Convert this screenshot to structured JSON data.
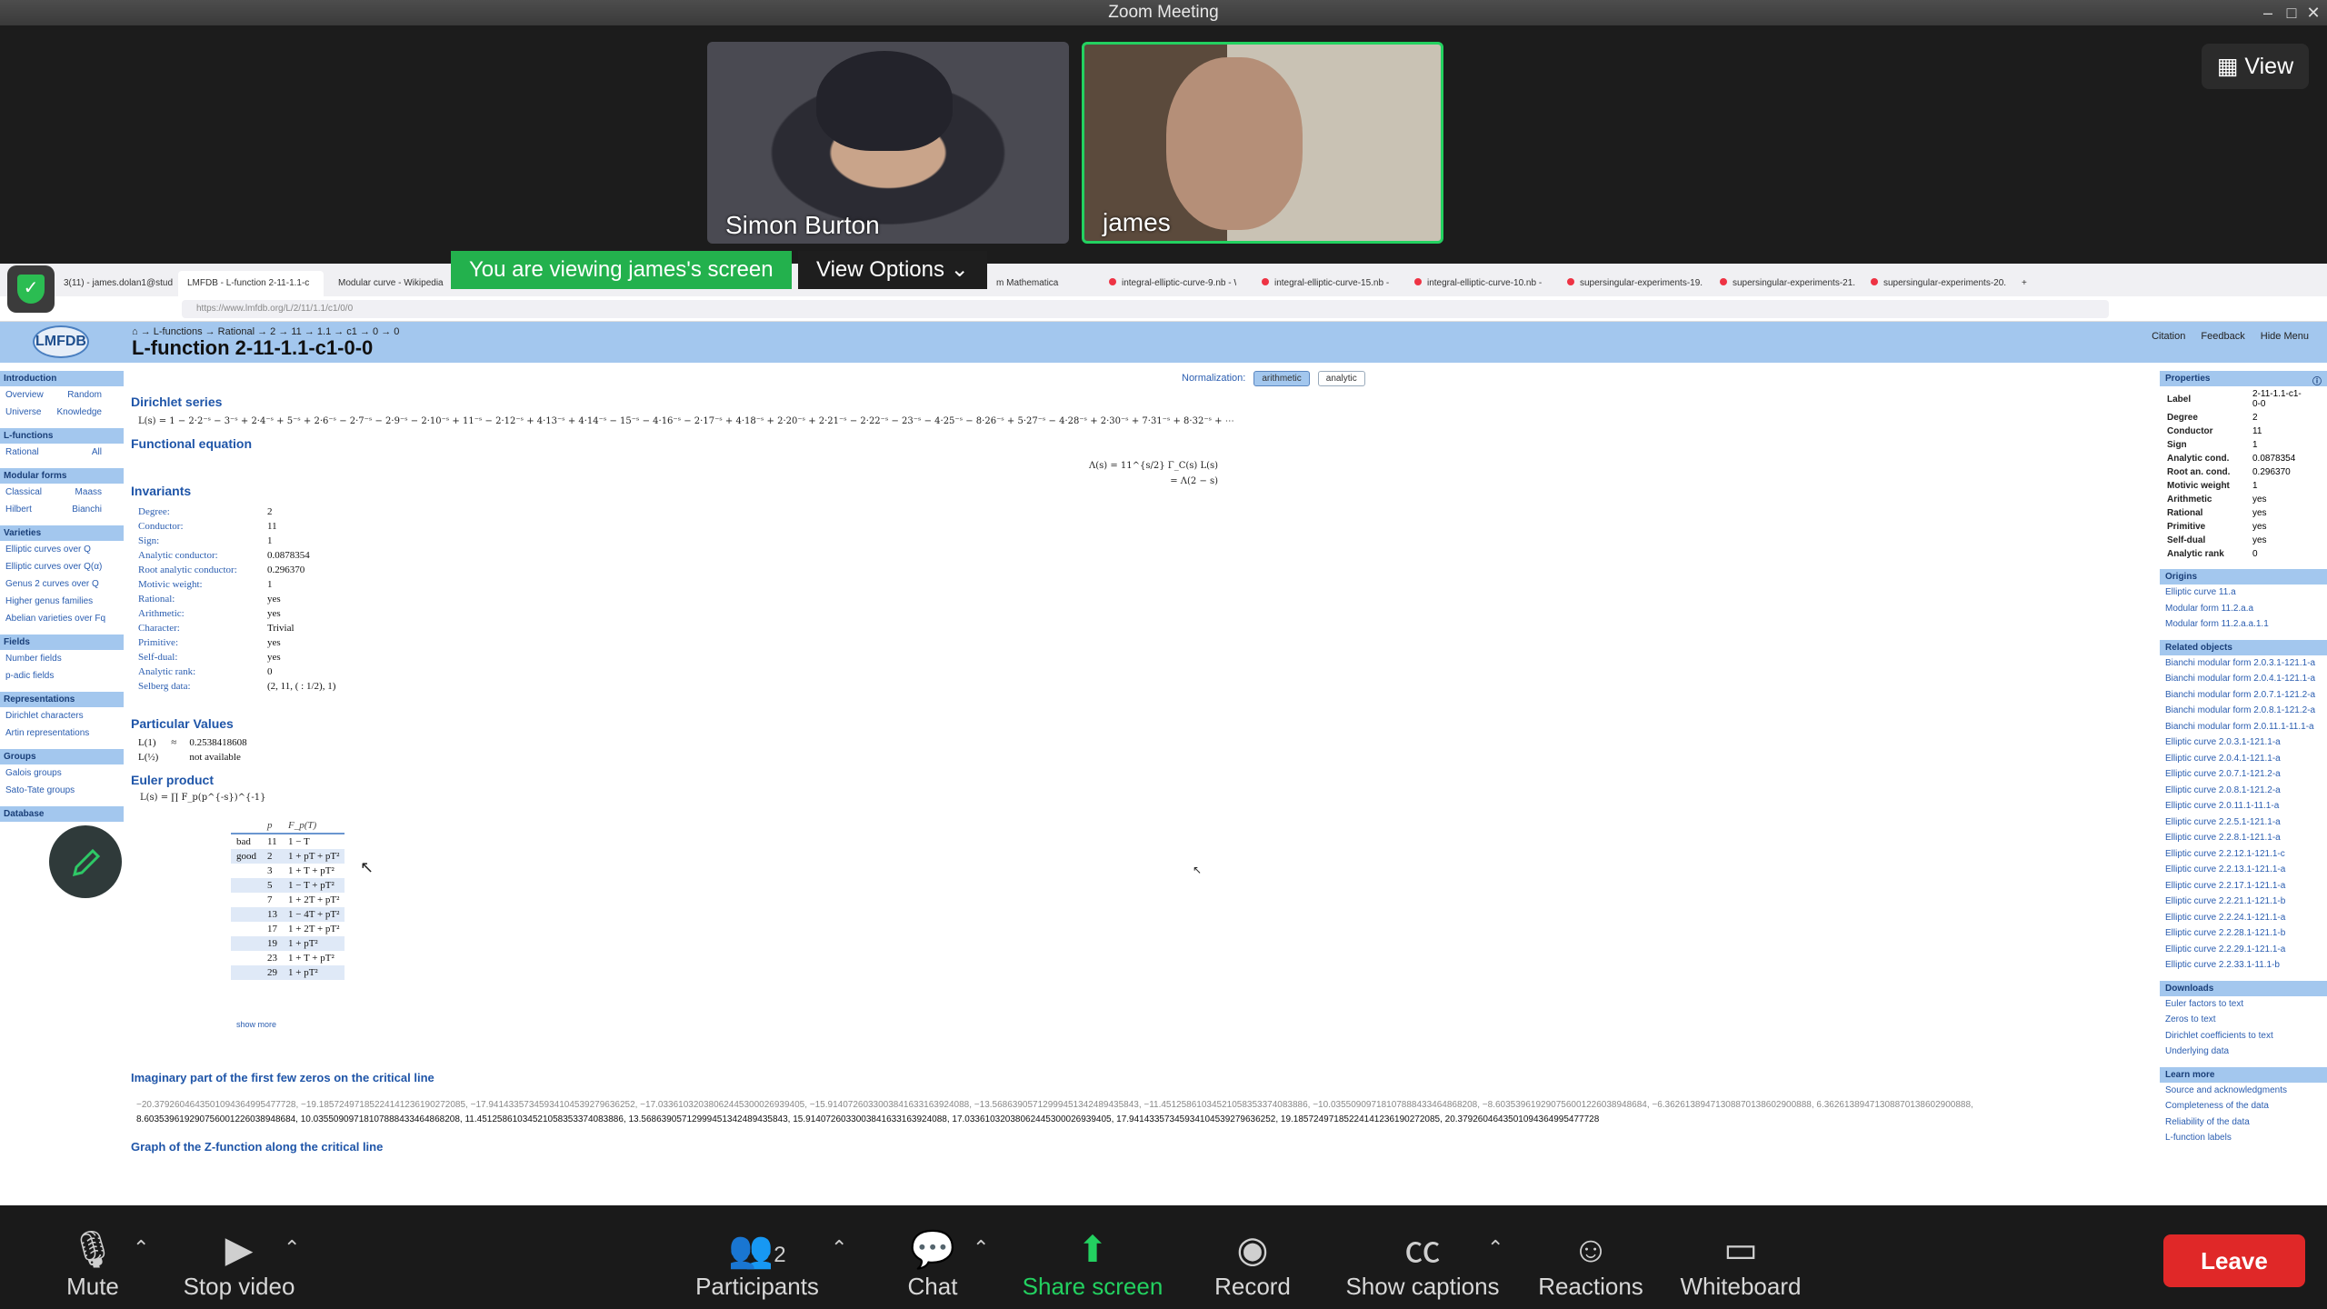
{
  "window": {
    "title": "Zoom Meeting"
  },
  "participants": [
    {
      "name": "Simon Burton"
    },
    {
      "name": "james"
    }
  ],
  "view_button": "View",
  "share_banner": {
    "text": "You are viewing james's screen",
    "options": "View Options"
  },
  "browser": {
    "tabs": [
      "3(11) - james.dolan1@stude",
      "LMFDB - L-function 2-11-1.1-c",
      "Modular curve - Wikipedia",
      "m Mathematica",
      "integral-elliptic-curve-9.nb - W",
      "integral-elliptic-curve-15.nb -",
      "integral-elliptic-curve-10.nb -",
      "supersingular-experiments-19.",
      "supersingular-experiments-21.",
      "supersingular-experiments-20."
    ],
    "url": "https://www.lmfdb.org/L/2/11/1.1/c1/0/0"
  },
  "lmfdb": {
    "logo": "LMFDB",
    "breadcrumb": "⌂ → L-functions → Rational → 2 → 11 → 1.1 → c1 → 0 → 0",
    "title": "L-function 2-11-1.1-c1-0-0",
    "top_links": [
      "Citation",
      "Feedback",
      "Hide Menu"
    ],
    "nav": [
      {
        "head": "Introduction",
        "rows": [
          [
            "Overview",
            "Random"
          ],
          [
            "Universe",
            "Knowledge"
          ]
        ]
      },
      {
        "head": "L-functions",
        "rows": [
          [
            "Rational",
            "All"
          ]
        ]
      },
      {
        "head": "Modular forms",
        "rows": [
          [
            "Classical",
            "Maass"
          ],
          [
            "Hilbert",
            "Bianchi"
          ]
        ]
      },
      {
        "head": "Varieties",
        "rows": [
          [
            "Elliptic curves over Q"
          ],
          [
            "Elliptic curves over Q(α)"
          ],
          [
            "Genus 2 curves over Q"
          ],
          [
            "Higher genus families"
          ],
          [
            "Abelian varieties over Fq"
          ]
        ]
      },
      {
        "head": "Fields",
        "rows": [
          [
            "Number fields"
          ],
          [
            "p-adic fields"
          ]
        ]
      },
      {
        "head": "Representations",
        "rows": [
          [
            "Dirichlet characters"
          ],
          [
            "Artin representations"
          ]
        ]
      },
      {
        "head": "Groups",
        "rows": [
          [
            "Galois groups"
          ],
          [
            "Sato-Tate groups"
          ]
        ]
      },
      {
        "head": "Database",
        "rows": []
      }
    ],
    "normalization": {
      "label": "Normalization:",
      "options": [
        "arithmetic",
        "analytic"
      ],
      "selected": "arithmetic"
    },
    "sections": {
      "dirichlet": "Dirichlet series",
      "functional": "Functional equation",
      "invariants": "Invariants",
      "particular": "Particular Values",
      "euler": "Euler product",
      "zeros": "Imaginary part of the first few zeros on the critical line",
      "graph": "Graph of the Z-function along the critical line"
    },
    "dirichlet_series": "L(s) = 1 − 2·2⁻ˢ − 3⁻ˢ + 2·4⁻ˢ + 5⁻ˢ + 2·6⁻ˢ − 2·7⁻ˢ − 2·9⁻ˢ − 2·10⁻ˢ + 11⁻ˢ − 2·12⁻ˢ + 4·13⁻ˢ + 4·14⁻ˢ − 15⁻ˢ − 4·16⁻ˢ − 2·17⁻ˢ + 4·18⁻ˢ + 2·20⁻ˢ + 2·21⁻ˢ − 2·22⁻ˢ − 23⁻ˢ − 4·25⁻ˢ − 8·26⁻ˢ + 5·27⁻ˢ − 4·28⁻ˢ + 2·30⁻ˢ + 7·31⁻ˢ + 8·32⁻ˢ + ⋯",
    "functional_eq": [
      "Λ(s) = 11^{s/2} Γ_C(s) L(s)",
      "= Λ(2 − s)"
    ],
    "invariants": [
      [
        "Degree:",
        "2"
      ],
      [
        "Conductor:",
        "11"
      ],
      [
        "Sign:",
        "1"
      ],
      [
        "Analytic conductor:",
        "0.0878354"
      ],
      [
        "Root analytic conductor:",
        "0.296370"
      ],
      [
        "Motivic weight:",
        "1"
      ],
      [
        "Rational:",
        "yes"
      ],
      [
        "Arithmetic:",
        "yes"
      ],
      [
        "Character:",
        "Trivial"
      ],
      [
        "Primitive:",
        "yes"
      ],
      [
        "Self-dual:",
        "yes"
      ],
      [
        "Analytic rank:",
        "0"
      ],
      [
        "Selberg data:",
        "(2, 11, ( : 1/2), 1)"
      ]
    ],
    "particular_values": [
      [
        "L(1)",
        "≈",
        "0.2538418608"
      ],
      [
        "L(½)",
        "",
        "not available"
      ]
    ],
    "euler_formula": "L(s) = ∏ F_p(p^{-s})^{-1}",
    "euler_headers": [
      "",
      "p",
      "F_p(T)"
    ],
    "euler_rows": [
      [
        "bad",
        "11",
        "1 − T"
      ],
      [
        "good",
        "2",
        "1 + pT + pT²"
      ],
      [
        "",
        "3",
        "1 + T + pT²"
      ],
      [
        "",
        "5",
        "1 − T + pT²"
      ],
      [
        "",
        "7",
        "1 + 2T + pT²"
      ],
      [
        "",
        "13",
        "1 − 4T + pT²"
      ],
      [
        "",
        "17",
        "1 + 2T + pT²"
      ],
      [
        "",
        "19",
        "1 + pT²"
      ],
      [
        "",
        "23",
        "1 + T + pT²"
      ],
      [
        "",
        "29",
        "1 + pT²"
      ]
    ],
    "show_more": "show more",
    "zeros_line1": "−20.3792604643501094364995477728, −19.1857249718522414123619027208​5, −17.9414335734593410453927963​6252, −17.0336103203806244530002693940​5, −15.9140726033003841633​1639​24088, −13.5686390571299945134​2489435843, −11.4512586103452105835​3374083886, −10.0355090971810788843​3464868208, −8.60353961929075600122​603​8948684, −6.36261389471308870138602900888, 6.36261389471308870138602900888,",
    "zeros_line2": "8.60353961929075600122603​8948684, 10.0355090971810788843​3464868208, 11.4512586103452105835​3374083886, 13.5686390571299945134​2489435843, 15.9140726033003841633​1639​24088, 17.0336103203806244530002693940​5, 17.9414335734593410453927963​6252, 19.1857249718522414123619027208​5, 20.3792604643501094364995477728"
  },
  "properties": {
    "title": "Properties",
    "rows": [
      [
        "Label",
        "2-11-1.1-c1-0-0"
      ],
      [
        "Degree",
        "2"
      ],
      [
        "Conductor",
        "11"
      ],
      [
        "Sign",
        "1"
      ],
      [
        "Analytic cond.",
        "0.0878354"
      ],
      [
        "Root an. cond.",
        "0.296370"
      ],
      [
        "Motivic weight",
        "1"
      ],
      [
        "Arithmetic",
        "yes"
      ],
      [
        "Rational",
        "yes"
      ],
      [
        "Primitive",
        "yes"
      ],
      [
        "Self-dual",
        "yes"
      ],
      [
        "Analytic rank",
        "0"
      ]
    ],
    "origins_title": "Origins",
    "origins": [
      "Elliptic curve 11.a",
      "Modular form 11.2.a.a",
      "Modular form 11.2.a.a.1.1"
    ],
    "related_title": "Related objects",
    "related": [
      "Bianchi modular form 2.0.3.1-121.1-a",
      "Bianchi modular form 2.0.4.1-121.1-a",
      "Bianchi modular form 2.0.7.1-121.2-a",
      "Bianchi modular form 2.0.8.1-121.2-a",
      "Bianchi modular form 2.0.11.1-11.1-a",
      "Elliptic curve 2.0.3.1-121.1-a",
      "Elliptic curve 2.0.4.1-121.1-a",
      "Elliptic curve 2.0.7.1-121.2-a",
      "Elliptic curve 2.0.8.1-121.2-a",
      "Elliptic curve 2.0.11.1-11.1-a",
      "Elliptic curve 2.2.5.1-121.1-a",
      "Elliptic curve 2.2.8.1-121.1-a",
      "Elliptic curve 2.2.12.1-121.1-c",
      "Elliptic curve 2.2.13.1-121.1-a",
      "Elliptic curve 2.2.17.1-121.1-a",
      "Elliptic curve 2.2.21.1-121.1-b",
      "Elliptic curve 2.2.24.1-121.1-a",
      "Elliptic curve 2.2.28.1-121.1-b",
      "Elliptic curve 2.2.29.1-121.1-a",
      "Elliptic curve 2.2.33.1-11.1-b"
    ],
    "downloads_title": "Downloads",
    "downloads": [
      "Euler factors to text",
      "Zeros to text",
      "Dirichlet coefficients to text",
      "Underlying data"
    ],
    "learn_title": "Learn more",
    "learn": [
      "Source and acknowledgments",
      "Completeness of the data",
      "Reliability of the data",
      "L-function labels"
    ]
  },
  "toolbar": {
    "mute": "Mute",
    "stop_video": "Stop video",
    "participants": "Participants",
    "participants_count": "2",
    "chat": "Chat",
    "share": "Share screen",
    "record": "Record",
    "captions": "Show captions",
    "reactions": "Reactions",
    "whiteboard": "Whiteboard",
    "leave": "Leave"
  },
  "colors": {
    "share_green": "#23b14d",
    "leave_red": "#e02828",
    "lmfdb_blue": "#a3c7ee"
  }
}
